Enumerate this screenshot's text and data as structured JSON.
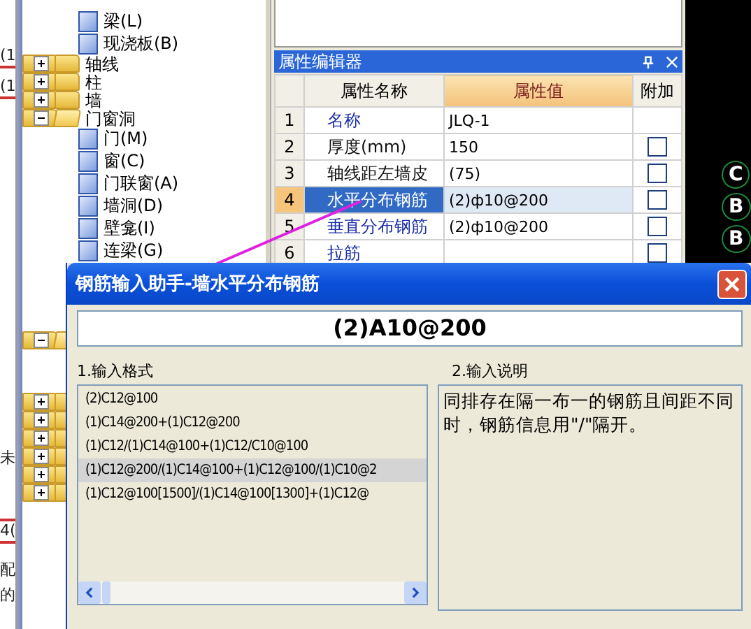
{
  "left_strip": {
    "fragments": [
      "(1",
      "(1",
      "未",
      "4(",
      "配",
      "的"
    ]
  },
  "tree": {
    "items": [
      {
        "kind": "leaf",
        "label": "梁(L)"
      },
      {
        "kind": "leaf",
        "label": "现浇板(B)"
      },
      {
        "kind": "folder",
        "label": "轴线",
        "expanded": false
      },
      {
        "kind": "folder",
        "label": "柱",
        "expanded": false
      },
      {
        "kind": "folder",
        "label": "墙",
        "expanded": false
      },
      {
        "kind": "folder",
        "label": "门窗洞",
        "expanded": true,
        "children": [
          {
            "label": "门(M)"
          },
          {
            "label": "窗(C)"
          },
          {
            "label": "门联窗(A)"
          },
          {
            "label": "墙洞(D)"
          },
          {
            "label": "壁龛(I)"
          },
          {
            "label": "连梁(G)"
          }
        ]
      }
    ],
    "lower_groups": [
      {
        "expanded": true
      },
      {
        "expanded": false
      },
      {
        "expanded": false
      },
      {
        "expanded": false
      },
      {
        "expanded": false
      },
      {
        "expanded": false
      },
      {
        "expanded": false
      }
    ]
  },
  "property_editor": {
    "title": "属性编辑器",
    "columns": [
      "属性名称",
      "属性值",
      "附加"
    ],
    "rows": [
      {
        "index": "1",
        "name": "名称",
        "value": "JLQ-1",
        "highlighted": true,
        "selected": false
      },
      {
        "index": "2",
        "name": "厚度(mm)",
        "value": "150",
        "highlighted": false,
        "selected": false,
        "checked": false
      },
      {
        "index": "3",
        "name": "轴线距左墙皮",
        "value": "(75)",
        "highlighted": false,
        "selected": false,
        "checked": false
      },
      {
        "index": "4",
        "name": "水平分布钢筋",
        "value": "(2)ф10@200",
        "highlighted": true,
        "selected": true,
        "checked": false
      },
      {
        "index": "5",
        "name": "垂直分布钢筋",
        "value": "(2)ф10@200",
        "highlighted": true,
        "selected": false,
        "checked": false
      },
      {
        "index": "6",
        "name": "拉筋",
        "value": "",
        "highlighted": true,
        "selected": false,
        "checked": false
      }
    ]
  },
  "canvas": {
    "axis_labels": [
      "C",
      "B",
      "B"
    ]
  },
  "dialog": {
    "title": "钢筋输入助手-墙水平分布钢筋",
    "input_value": "(2)A10@200",
    "format_label": "1.输入格式",
    "formats": [
      {
        "text": "(2)C12@100",
        "selected": false
      },
      {
        "text": "(1)C14@200+(1)C12@200",
        "selected": false
      },
      {
        "text": "(1)C12/(1)C14@100+(1)C12/C10@100",
        "selected": false
      },
      {
        "text": "(1)C12@200/(1)C14@100+(1)C12@100/(1)C10@2",
        "selected": true
      },
      {
        "text": "(1)C12@100[1500]/(1)C14@100[1300]+(1)C12@",
        "selected": false
      }
    ],
    "note_label": "2.输入说明",
    "note": "同排存在隔一布一的钢筋且间距不同时，钢筋信息用\"/\"隔开。"
  }
}
